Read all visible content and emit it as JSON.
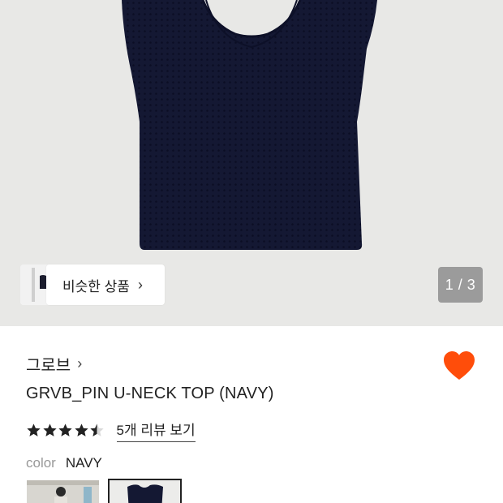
{
  "gallery": {
    "similar_label": "비슷한 상품",
    "pager": "1 / 3"
  },
  "product": {
    "brand": "그로브",
    "title": "GRVB_PIN U-NECK TOP (NAVY)",
    "rating_value": 4.5,
    "review_link": "5개 리뷰 보기",
    "color_label": "color",
    "color_value": "NAVY",
    "favorited": true
  },
  "colors": {
    "accent": "#ff4d0a",
    "knit": "#141833",
    "background": "#e8e8e6"
  }
}
